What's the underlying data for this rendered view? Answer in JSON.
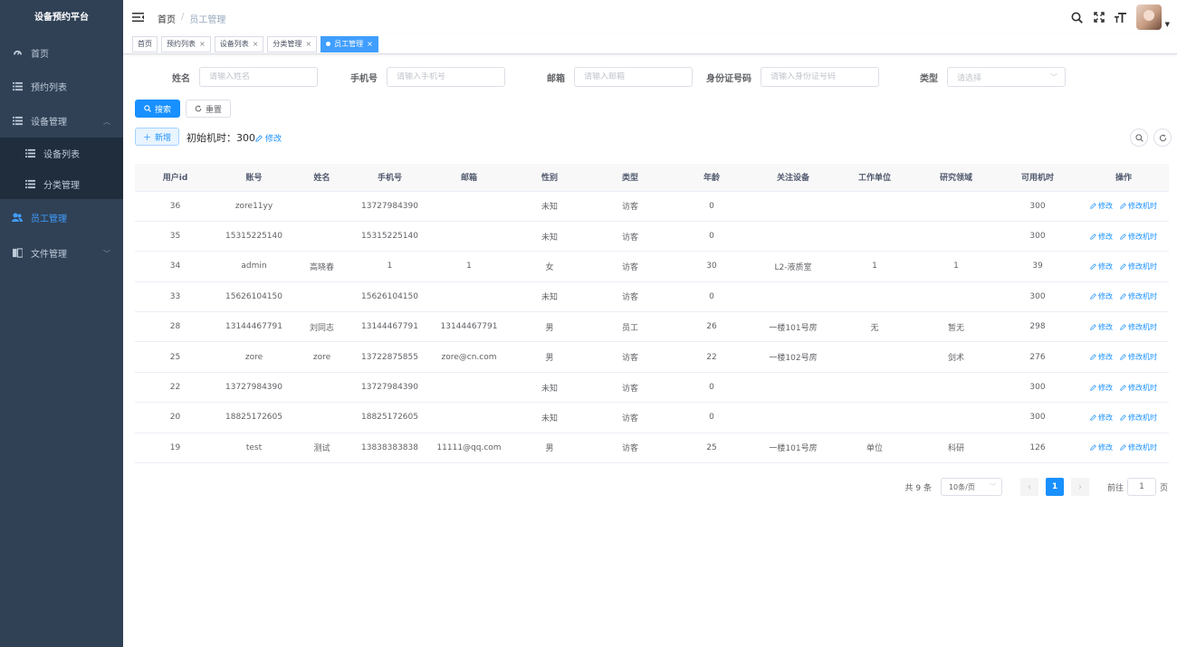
{
  "app": {
    "title": "设备预约平台"
  },
  "sidebar": {
    "items": [
      {
        "label": "首页",
        "icon": "dashboard-icon"
      },
      {
        "label": "预约列表",
        "icon": "list-icon"
      },
      {
        "label": "设备管理",
        "icon": "list-icon"
      },
      {
        "label": "设备列表",
        "icon": "list-icon"
      },
      {
        "label": "分类管理",
        "icon": "list-icon"
      },
      {
        "label": "员工管理",
        "icon": "peoples-icon"
      },
      {
        "label": "文件管理",
        "icon": "document-icon"
      }
    ]
  },
  "header": {
    "breadcrumb": {
      "home": "首页",
      "sep": "/",
      "current": "员工管理"
    }
  },
  "tags": [
    {
      "label": "首页"
    },
    {
      "label": "预约列表"
    },
    {
      "label": "设备列表"
    },
    {
      "label": "分类管理"
    },
    {
      "label": "员工管理"
    }
  ],
  "search": {
    "name_label": "姓名",
    "name_placeholder": "请输入姓名",
    "phone_label": "手机号",
    "phone_placeholder": "请输入手机号",
    "email_label": "邮箱",
    "email_placeholder": "请输入邮箱",
    "idcard_label": "身份证号码",
    "idcard_placeholder": "请输入身份证号码",
    "type_label": "类型",
    "type_placeholder": "请选择",
    "search_btn": "搜索",
    "reset_btn": "重置"
  },
  "toolbar": {
    "add_btn": "新增",
    "init_label": "初始机时：300",
    "edit_label": "修改"
  },
  "table": {
    "columns": [
      "用户id",
      "账号",
      "姓名",
      "手机号",
      "邮箱",
      "性别",
      "类型",
      "年龄",
      "关注设备",
      "工作单位",
      "研究领域",
      "可用机时",
      "操作"
    ],
    "op_edit": "修改",
    "op_edit_hours": "修改机时",
    "rows": [
      [
        "36",
        "zore11yy",
        "",
        "13727984390",
        "",
        "未知",
        "访客",
        "0",
        "",
        "",
        "",
        "300"
      ],
      [
        "35",
        "15315225140",
        "",
        "15315225140",
        "",
        "未知",
        "访客",
        "0",
        "",
        "",
        "",
        "300"
      ],
      [
        "34",
        "admin",
        "高晓春",
        "1",
        "1",
        "女",
        "访客",
        "30",
        "L2-液质室",
        "1",
        "1",
        "39"
      ],
      [
        "33",
        "15626104150",
        "",
        "15626104150",
        "",
        "未知",
        "访客",
        "0",
        "",
        "",
        "",
        "300"
      ],
      [
        "28",
        "13144467791",
        "刘同志",
        "13144467791",
        "13144467791",
        "男",
        "员工",
        "26",
        "一楼101号房",
        "无",
        "暂无",
        "298"
      ],
      [
        "25",
        "zore",
        "zore",
        "13722875855",
        "zore@cn.com",
        "男",
        "访客",
        "22",
        "一楼102号房",
        "",
        "剑术",
        "276"
      ],
      [
        "22",
        "13727984390",
        "",
        "13727984390",
        "",
        "未知",
        "访客",
        "0",
        "",
        "",
        "",
        "300"
      ],
      [
        "20",
        "18825172605",
        "",
        "18825172605",
        "",
        "未知",
        "访客",
        "0",
        "",
        "",
        "",
        "300"
      ],
      [
        "19",
        "test",
        "测试",
        "13838383838",
        "11111@qq.com",
        "男",
        "访客",
        "25",
        "一楼101号房",
        "单位",
        "科研",
        "126"
      ]
    ]
  },
  "pagination": {
    "total": "共 9 条",
    "page_size": "10条/页",
    "current": "1",
    "jump_prefix": "前往",
    "jump_value": "1",
    "jump_suffix": "页"
  },
  "colors": {
    "sidebar_bg": "#304156",
    "accent": "#1890ff",
    "active_menu": "#409eff"
  }
}
